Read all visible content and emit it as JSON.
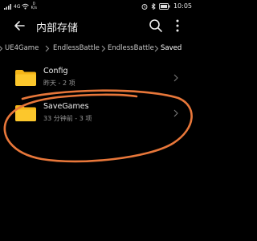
{
  "status_bar": {
    "carrier_text": "4G",
    "net_speed_value": "0",
    "net_speed_unit": "K/s",
    "battery_level": "",
    "time": "10:05"
  },
  "toolbar": {
    "title": "内部存储",
    "back_icon": "arrow-left-icon",
    "search_icon": "search-icon",
    "more_icon": "more-vertical-icon"
  },
  "breadcrumb": {
    "items": [
      "UE4Game",
      "EndlessBattle",
      "EndlessBattle",
      "Saved"
    ]
  },
  "files": [
    {
      "name": "Config",
      "meta": "昨天 - 2 项",
      "icon": "folder-icon"
    },
    {
      "name": "SaveGames",
      "meta": "33 分钟前 - 3 项",
      "icon": "folder-icon"
    }
  ],
  "annotation": {
    "color": "#e8773a"
  },
  "colors": {
    "folder": "#f5b618",
    "background": "#000000"
  }
}
